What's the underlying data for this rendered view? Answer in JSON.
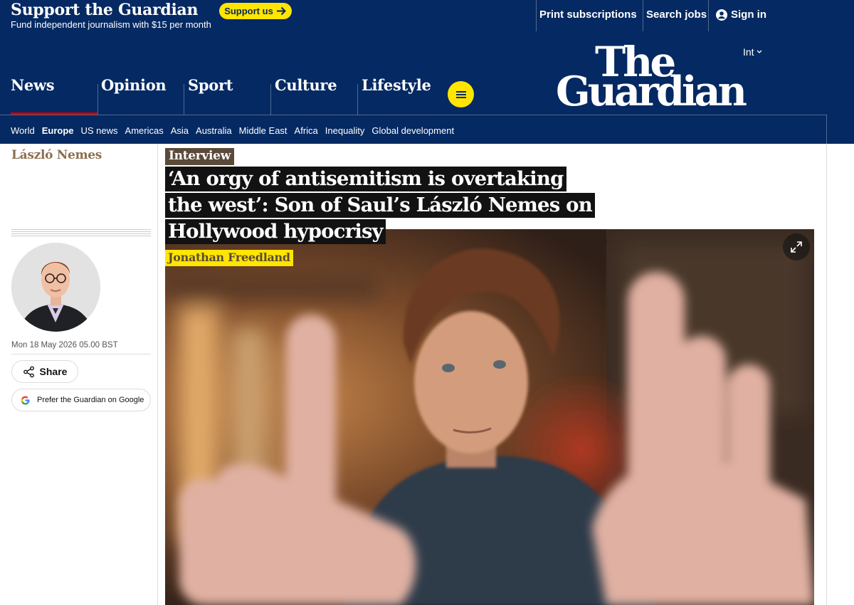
{
  "support": {
    "title": "Support the Guardian",
    "subtitle": "Fund independent journalism with $15 per month",
    "button_label": "Support us"
  },
  "top_links": {
    "print": "Print subscriptions",
    "jobs": "Search jobs",
    "sign_in": "Sign in"
  },
  "edition": "Int",
  "logo": {
    "line1": "The",
    "line2": "Guardian"
  },
  "pillars": [
    "News",
    "Opinion",
    "Sport",
    "Culture",
    "Lifestyle"
  ],
  "subnav": [
    "World",
    "Europe",
    "US news",
    "Americas",
    "Asia",
    "Australia",
    "Middle East",
    "Africa",
    "Inequality",
    "Global development"
  ],
  "subnav_active": "Europe",
  "meta": {
    "series": "László Nemes",
    "date": "Mon 18 May 2026 05.00 BST",
    "share_label": "Share",
    "google_label": "Prefer the Guardian on Google"
  },
  "article": {
    "kicker": "Interview",
    "headline": "‘An orgy of antisemitism is overtaking the west’: Son of Saul’s László Nemes on Hollywood hypocrisy",
    "byline": "Jonathan Freedland"
  },
  "colors": {
    "brand": "#052962",
    "highlight": "#ffe500",
    "culture_kicker": "#5b4a3a",
    "news_underline": "#c70000"
  }
}
